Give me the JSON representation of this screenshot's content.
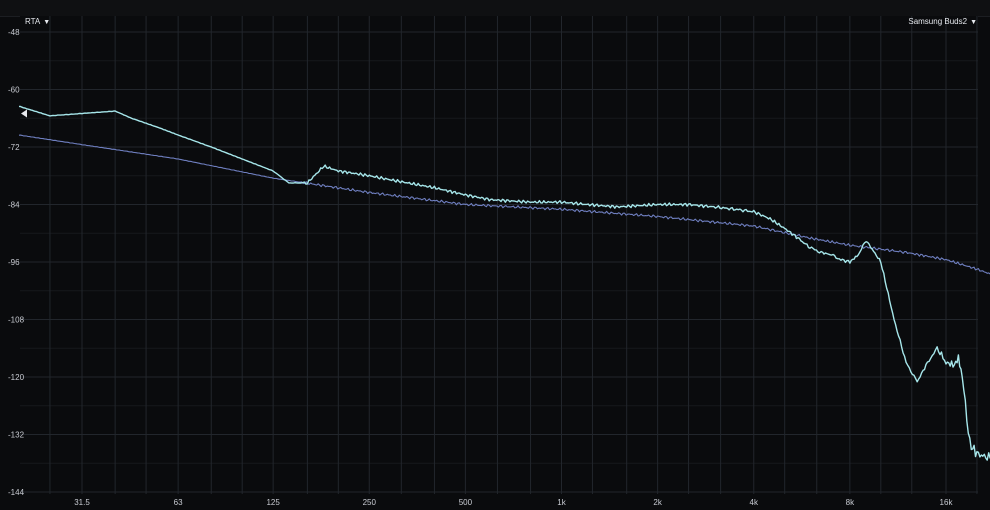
{
  "toolbar": {
    "left_dropdown_label": "RTA",
    "right_dropdown_label": "Samsung Buds2",
    "caret_icon": "caret-down-icon"
  },
  "colors": {
    "background": "#0a0b0d",
    "grid": "#22262c",
    "series_1": "#a6e6ea",
    "series_2": "#6f7fc0",
    "tick_text": "#c9ccd3"
  },
  "chart_data": {
    "type": "line",
    "title": "",
    "xlabel": "",
    "ylabel": "",
    "x_scale": "log",
    "xlim": [
      20,
      22000
    ],
    "ylim": [
      -144,
      -48
    ],
    "grid": true,
    "legend": "none",
    "y_ticks": [
      -48,
      -60,
      -72,
      -84,
      -96,
      -108,
      -120,
      -132,
      -144
    ],
    "x_ticks": [
      {
        "value": 31.5,
        "label": "31.5"
      },
      {
        "value": 63,
        "label": "63"
      },
      {
        "value": 125,
        "label": "125"
      },
      {
        "value": 250,
        "label": "250"
      },
      {
        "value": 500,
        "label": "500"
      },
      {
        "value": 1000,
        "label": "1k"
      },
      {
        "value": 2000,
        "label": "2k"
      },
      {
        "value": 4000,
        "label": "4k"
      },
      {
        "value": 8000,
        "label": "8k"
      },
      {
        "value": 16000,
        "label": "16k"
      }
    ],
    "reference_marker_db": -65,
    "series": [
      {
        "color": "#a6e6ea",
        "x": [
          20,
          25,
          31.5,
          40,
          45,
          55,
          63,
          80,
          100,
          125,
          140,
          160,
          180,
          200,
          250,
          300,
          400,
          500,
          600,
          800,
          1000,
          1200,
          1500,
          2000,
          2500,
          3000,
          3500,
          4000,
          4500,
          5000,
          5500,
          6000,
          6500,
          7000,
          7500,
          8000,
          8500,
          9000,
          10000,
          11000,
          12000,
          13000,
          14000,
          15000,
          16000,
          17000,
          17500,
          18000,
          19000,
          20000,
          22000
        ],
        "y": [
          -63.5,
          -65.5,
          -65,
          -64.5,
          -66,
          -68,
          -69.5,
          -72,
          -74.5,
          -77,
          -79.5,
          -79.5,
          -76,
          -77,
          -78,
          -79,
          -80.5,
          -82,
          -83,
          -83.5,
          -83.5,
          -84,
          -84.5,
          -84,
          -84,
          -84.5,
          -85,
          -85.5,
          -87,
          -89,
          -91,
          -93,
          -94,
          -94.5,
          -95.5,
          -96,
          -94.5,
          -91.5,
          -96,
          -108,
          -117,
          -121,
          -117,
          -114,
          -117,
          -117.5,
          -116,
          -120,
          -134,
          -136,
          -137
        ]
      },
      {
        "color": "#6f7fc0",
        "x": [
          20,
          31.5,
          63,
          125,
          250,
          500,
          1000,
          2000,
          4000,
          6000,
          8000,
          12000,
          16000,
          20000,
          22000
        ],
        "y": [
          -69.5,
          -71.5,
          -74.5,
          -78.5,
          -81.5,
          -84,
          -85,
          -86.5,
          -88.5,
          -91,
          -92.5,
          -94,
          -95.5,
          -97.5,
          -98.5
        ]
      }
    ]
  }
}
